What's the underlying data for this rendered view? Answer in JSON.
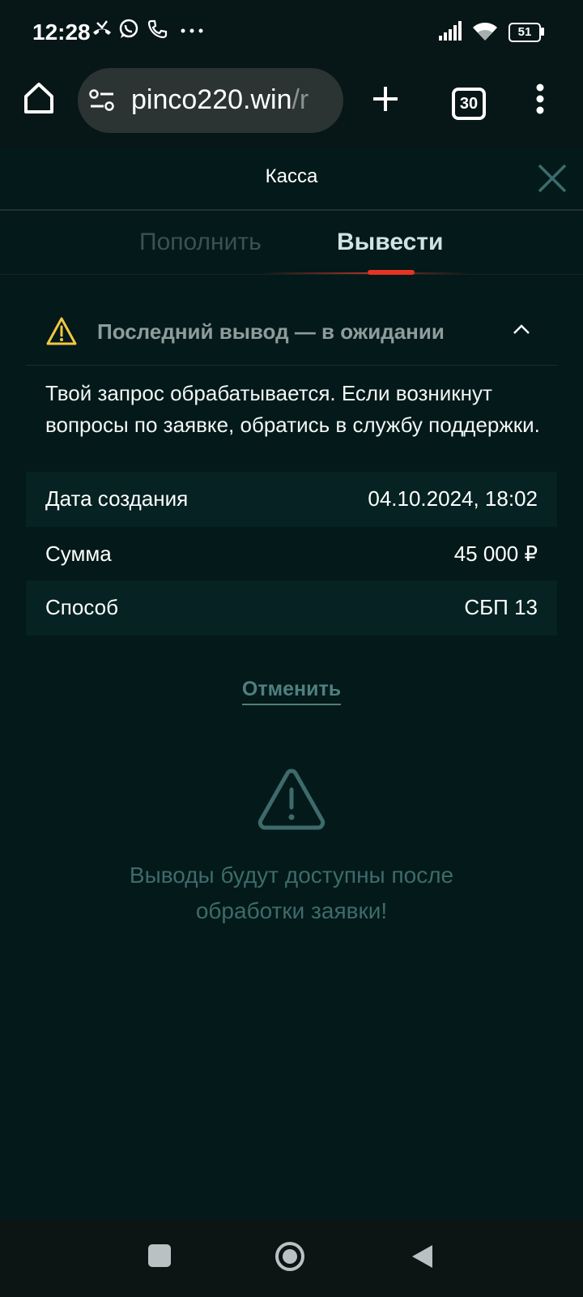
{
  "status_bar": {
    "time": "12:28",
    "battery": "51",
    "icons": [
      "missed-call-icon",
      "whatsapp-icon",
      "call-icon",
      "more-dots-icon",
      "signal-icon",
      "wifi-icon",
      "battery-icon"
    ]
  },
  "browser": {
    "url_main": "pinco220.win",
    "url_rest": "/r",
    "tab_count": "30"
  },
  "app": {
    "title": "Касса"
  },
  "tabs": {
    "deposit": "Пополнить",
    "withdraw": "Вывести",
    "active": "withdraw"
  },
  "pending": {
    "title": "Последний вывод — в ожидании",
    "message": "Твой запрос обрабатывается. Если возникнут вопросы по заявке, обратись в службу поддержки.",
    "rows": [
      {
        "label": "Дата создания",
        "value": "04.10.2024, 18:02"
      },
      {
        "label": "Сумма",
        "value": "45 000 ₽"
      },
      {
        "label": "Способ",
        "value": "СБП 13"
      }
    ],
    "cancel_label": "Отменить"
  },
  "notice": {
    "line1": "Выводы будут доступны после",
    "line2": "обработки заявки!"
  },
  "colors": {
    "background": "#041919",
    "accent_red": "#e53423",
    "warning_yellow": "#f2c744",
    "muted_teal": "#3d6b6b"
  }
}
